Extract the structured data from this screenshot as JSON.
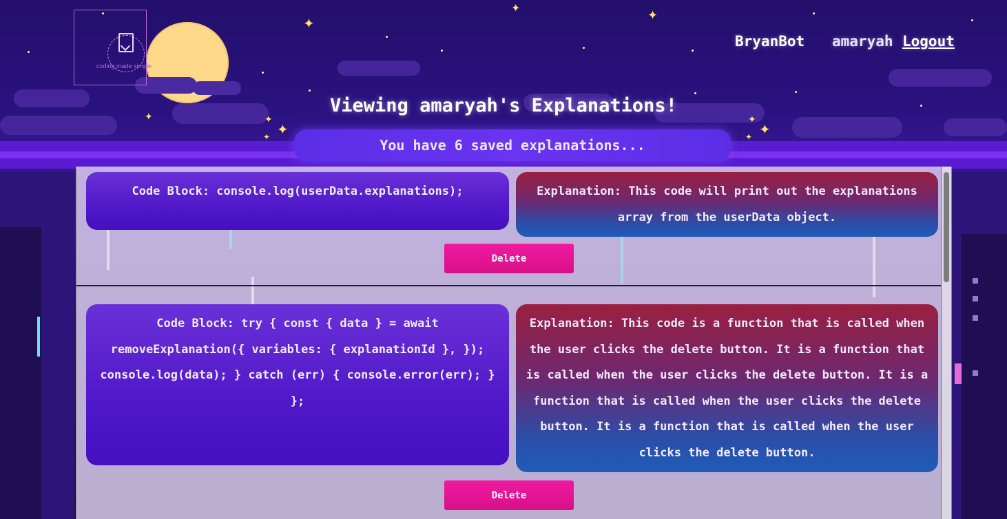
{
  "header": {
    "logo_tagline": "coding made simple",
    "brand": "BryanBot",
    "username": "amaryah",
    "logout_label": "Logout"
  },
  "page": {
    "title": "Viewing amaryah's Explanations!",
    "count_message": "You have 6 saved explanations..."
  },
  "explanations": [
    {
      "code": "Code Block: console.log(userData.explanations);",
      "explanation": "Explanation: This code will print out the explanations array from the userData object.",
      "delete_label": "Delete"
    },
    {
      "code": "Code Block: try { const { data } = await removeExplanation({ variables: { explanationId }, }); console.log(data); } catch (err) { console.error(err); } };",
      "explanation": "Explanation: This code is a function that is called when the user clicks the delete button. It is a function that is called when the user clicks the delete button. It is a function that is called when the user clicks the delete button. It is a function that is called when the user clicks the delete button.",
      "delete_label": "Delete"
    }
  ],
  "colors": {
    "background": "#22106a",
    "moon": "#ffd98a",
    "count_bar": "#6a34f0",
    "delete_button": "#e8149a",
    "code_card": "#5a1ed0",
    "explanation_card_top": "#9a2040",
    "explanation_card_bottom": "#1f5cb8"
  },
  "icons": {
    "logo": "bryanbot-logo-icon",
    "sparkle": "sparkle-icon",
    "moon": "moon-icon"
  }
}
